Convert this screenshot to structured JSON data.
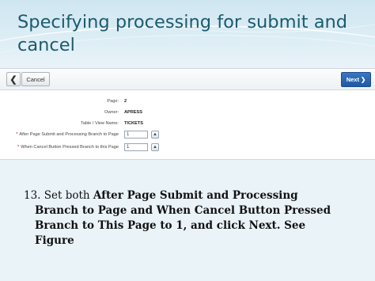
{
  "slide": {
    "title": "Specifying processing for submit and cancel"
  },
  "toolbar": {
    "cancel_label": "Cancel",
    "next_label": "Next"
  },
  "form": {
    "page": {
      "label": "Page:",
      "value": "2"
    },
    "owner": {
      "label": "Owner:",
      "value": "APRESS"
    },
    "table_view": {
      "label": "Table / View Name:",
      "value": "TICKETS"
    },
    "after_submit": {
      "required_mark": "*",
      "label": "After Page Submit and Processing Branch to Page",
      "value": "1"
    },
    "cancel_branch": {
      "required_mark": "*",
      "label": "When Cancel Button Pressed Branch to this Page",
      "value": "1"
    }
  },
  "instruction": {
    "l1_plain": "13. Set both ",
    "l1_bold": "After Page Submit and Processing",
    "l2_bold": "Branch to Page and When Cancel Button Pressed",
    "l3_bold": "Branch to This Page to 1, and click Next. See",
    "l4_bold": "Figure"
  }
}
